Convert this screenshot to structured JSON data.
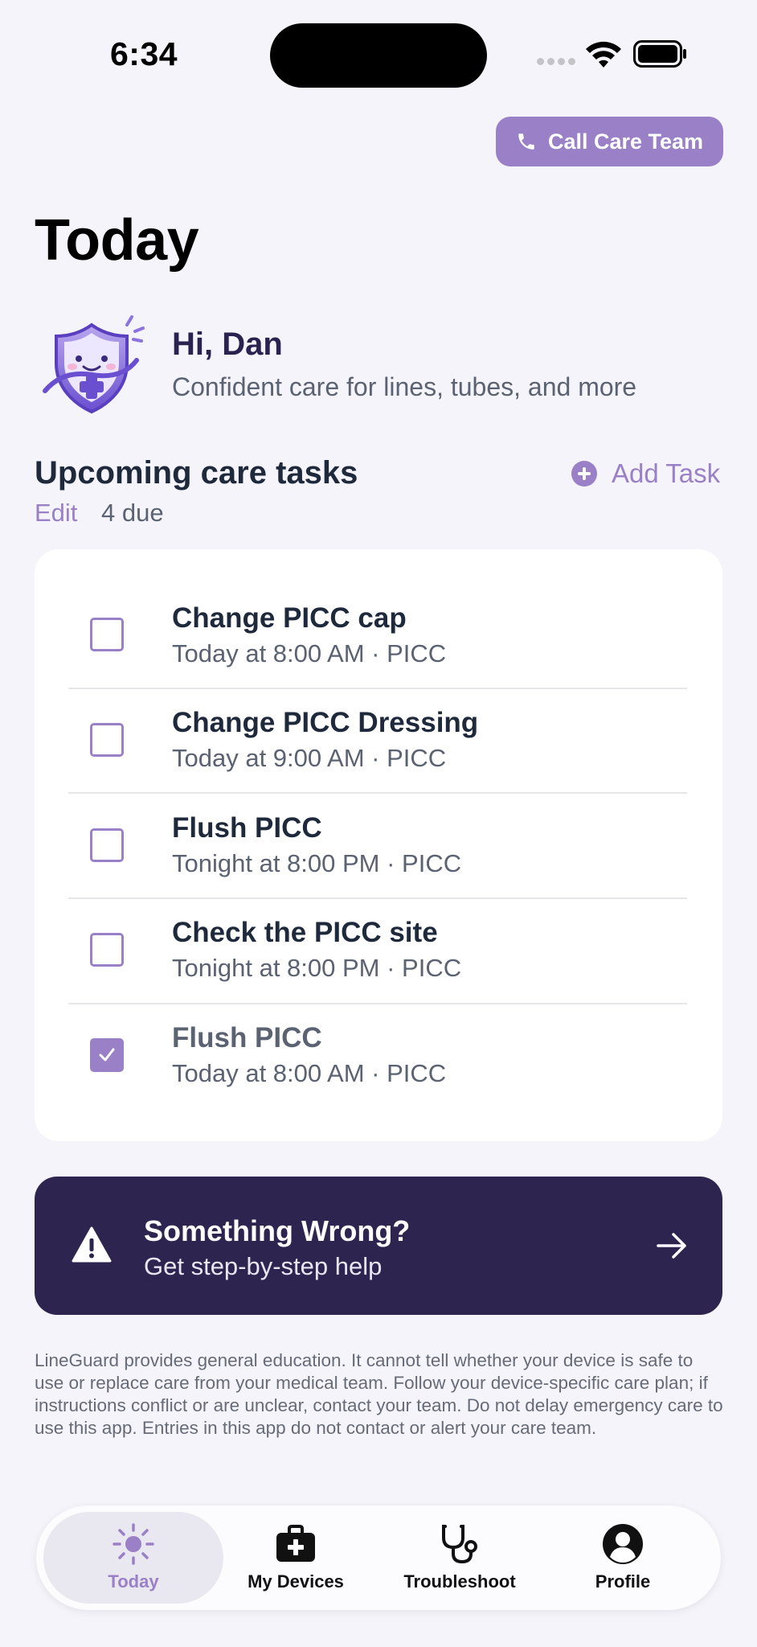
{
  "status_bar": {
    "time": "6:34"
  },
  "header": {
    "call_button_label": "Call Care Team",
    "title": "Today"
  },
  "greeting": {
    "title": "Hi, Dan",
    "subtitle": "Confident care for lines, tubes, and more"
  },
  "tasks_section": {
    "title": "Upcoming care tasks",
    "add_label": "Add Task",
    "edit_label": "Edit",
    "due_count": "4 due",
    "items": [
      {
        "title": "Change PICC cap",
        "subtitle": "Today at 8:00 AM · PICC",
        "checked": false
      },
      {
        "title": "Change PICC Dressing",
        "subtitle": "Today at 9:00 AM · PICC",
        "checked": false
      },
      {
        "title": "Flush PICC",
        "subtitle": "Tonight at 8:00 PM · PICC",
        "checked": false
      },
      {
        "title": "Check the PICC site",
        "subtitle": "Tonight at 8:00 PM · PICC",
        "checked": false
      },
      {
        "title": "Flush PICC",
        "subtitle": "Today at 8:00 AM · PICC",
        "checked": true
      }
    ]
  },
  "help_banner": {
    "title": "Something Wrong?",
    "subtitle": "Get step-by-step help"
  },
  "disclaimer": "LineGuard provides general education. It cannot tell whether your device is safe to use or replace care from your medical team. Follow your device-specific care plan; if instructions conflict or are unclear, contact your team. Do not delay emergency care to use this app. Entries in this app do not contact or alert your care team.",
  "tab_bar": {
    "tabs": [
      {
        "label": "Today",
        "icon": "sun-icon",
        "active": true
      },
      {
        "label": "My Devices",
        "icon": "medical-kit-icon",
        "active": false
      },
      {
        "label": "Troubleshoot",
        "icon": "stethoscope-icon",
        "active": false
      },
      {
        "label": "Profile",
        "icon": "person-circle-icon",
        "active": false
      }
    ]
  },
  "colors": {
    "accent": "#9a80c7",
    "banner": "#2d2550",
    "background": "#f5f4fb"
  }
}
